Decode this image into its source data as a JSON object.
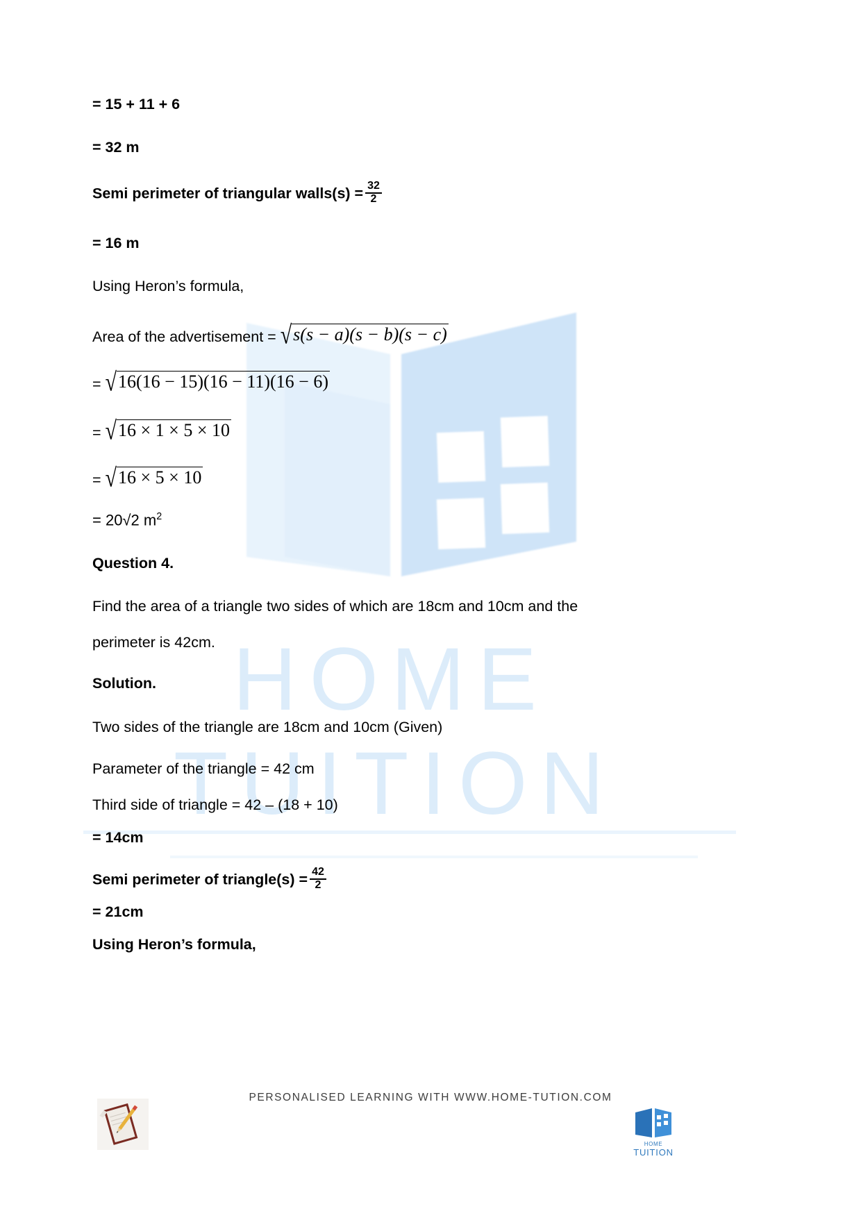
{
  "document": {
    "lines": {
      "l1": "= 15 + 11 + 6",
      "l2": "= 32 m",
      "l3_label": "Semi perimeter of triangular walls(s) =",
      "l3_num": "32",
      "l3_den": "2",
      "l4": "= 16 m",
      "l5": "Using Heron’s formula,",
      "l6_label": "Area of the advertisement =",
      "l6_radicand": "s(s − a)(s − b)(s − c)",
      "l7_eq": "=",
      "l7_radicand": "16(16 − 15)(16 − 11)(16 − 6)",
      "l8_eq": "=",
      "l8_radicand": "16 × 1 × 5 × 10",
      "l9_eq": "=",
      "l9_radicand": "16 × 5 × 10",
      "l10": "= 20√2 m",
      "l10_sup": "2",
      "q4_heading": "Question 4.",
      "q4_text_line1": "Find the area of a triangle two sides of which are 18cm and 10cm and the",
      "q4_text_line2": "perimeter is 42cm.",
      "solution_heading": "Solution.",
      "s1": "Two sides of the triangle are 18cm and 10cm (Given)",
      "s2": "Parameter of the triangle = 42 cm",
      "s3": "Third side of triangle = 42 – (18 + 10)",
      "s4": "= 14cm",
      "s5_label": "Semi perimeter of triangle(s) =",
      "s5_num": "42",
      "s5_den": "2",
      "s6": "= 21cm",
      "s7": "Using Heron’s formula,"
    },
    "watermark": {
      "word_home": "HOME",
      "word_tuition": "TUITION"
    },
    "footer": {
      "tagline": "PERSONALISED LEARNING WITH WWW.HOME-TUTION.COM",
      "logo_word_top": "HOME",
      "logo_word_bottom": "TUITION"
    },
    "colors": {
      "text": "#000000",
      "watermark_blue": "#dcecfa",
      "logo_blue": "#2f79bd",
      "footer_text": "#3d3d3d"
    }
  }
}
